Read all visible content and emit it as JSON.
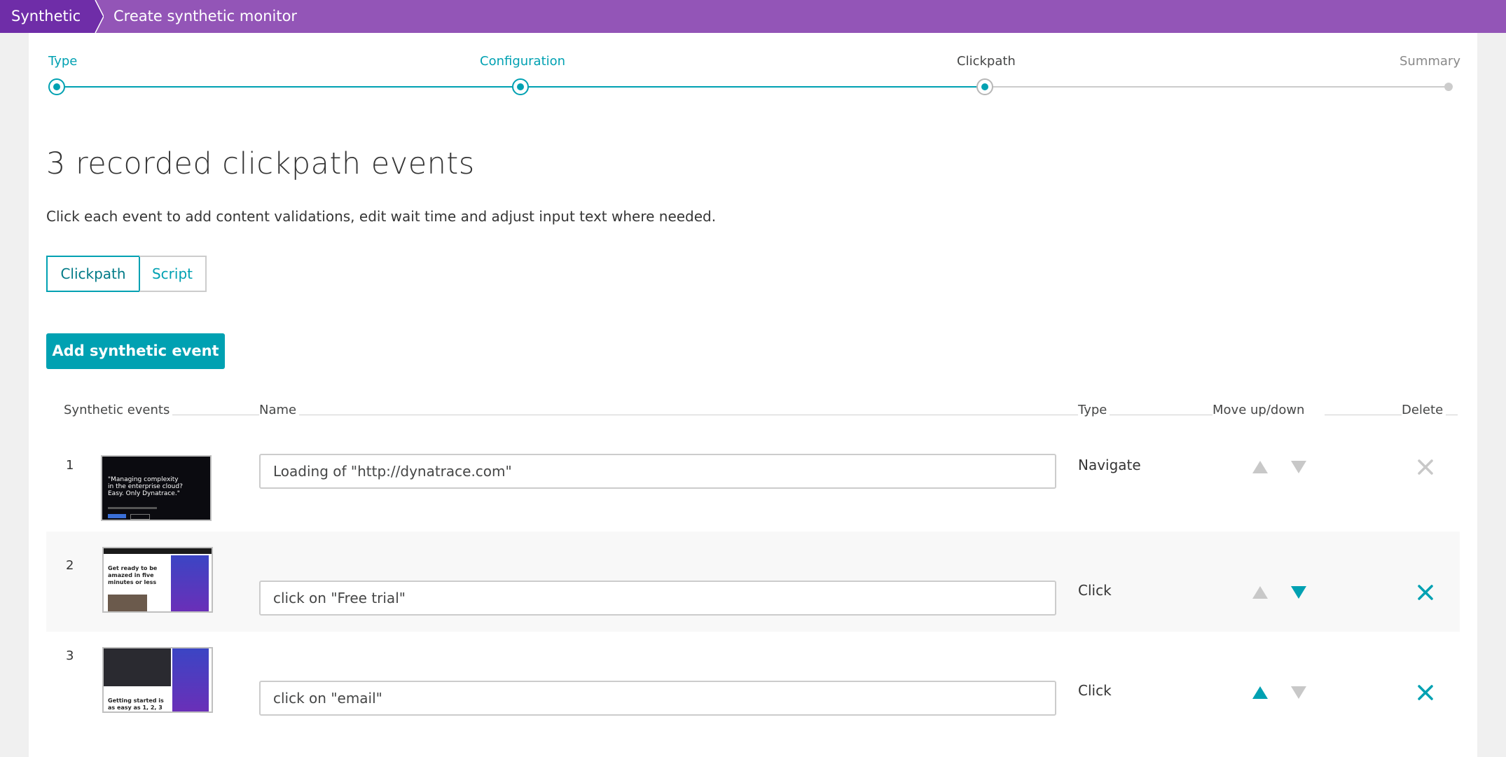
{
  "breadcrumb": {
    "root": "Synthetic",
    "current": "Create synthetic monitor"
  },
  "stepper": {
    "steps": [
      {
        "label": "Type",
        "state": "done"
      },
      {
        "label": "Configuration",
        "state": "done"
      },
      {
        "label": "Clickpath",
        "state": "current"
      },
      {
        "label": "Summary",
        "state": "todo"
      }
    ]
  },
  "page": {
    "title": "3 recorded clickpath events",
    "description": "Click each event to add content validations, edit wait time and adjust input text where needed."
  },
  "view_toggle": {
    "clickpath": "Clickpath",
    "script": "Script",
    "selected": "Clickpath"
  },
  "add_button": "Add synthetic event",
  "table": {
    "headers": {
      "events": "Synthetic events",
      "name": "Name",
      "type": "Type",
      "move": "Move up/down",
      "delete": "Delete"
    },
    "rows": [
      {
        "number": "1",
        "name": "Loading of \"http://dynatrace.com\"",
        "type": "Navigate",
        "thumb_text": "\"Managing complexity in the enterprise cloud? Easy. Only Dynatrace.\"",
        "move_up_enabled": false,
        "move_down_enabled": false,
        "delete_enabled": false
      },
      {
        "number": "2",
        "name": "click on \"Free trial\"",
        "type": "Click",
        "thumb_text": "Get ready to be amazed in five minutes or less",
        "move_up_enabled": false,
        "move_down_enabled": true,
        "delete_enabled": true
      },
      {
        "number": "3",
        "name": "click on \"email\"",
        "type": "Click",
        "thumb_text": "Getting started is as easy as 1, 2, 3",
        "move_up_enabled": true,
        "move_down_enabled": false,
        "delete_enabled": true
      }
    ]
  },
  "icons": {
    "move_up": "triangle-up-icon",
    "move_down": "triangle-down-icon",
    "delete": "close-icon"
  },
  "colors": {
    "brand_purple": "#9355b7",
    "brand_purple_dark": "#6f2da8",
    "accent": "#00a1b2",
    "disabled": "#c8c8c8"
  }
}
